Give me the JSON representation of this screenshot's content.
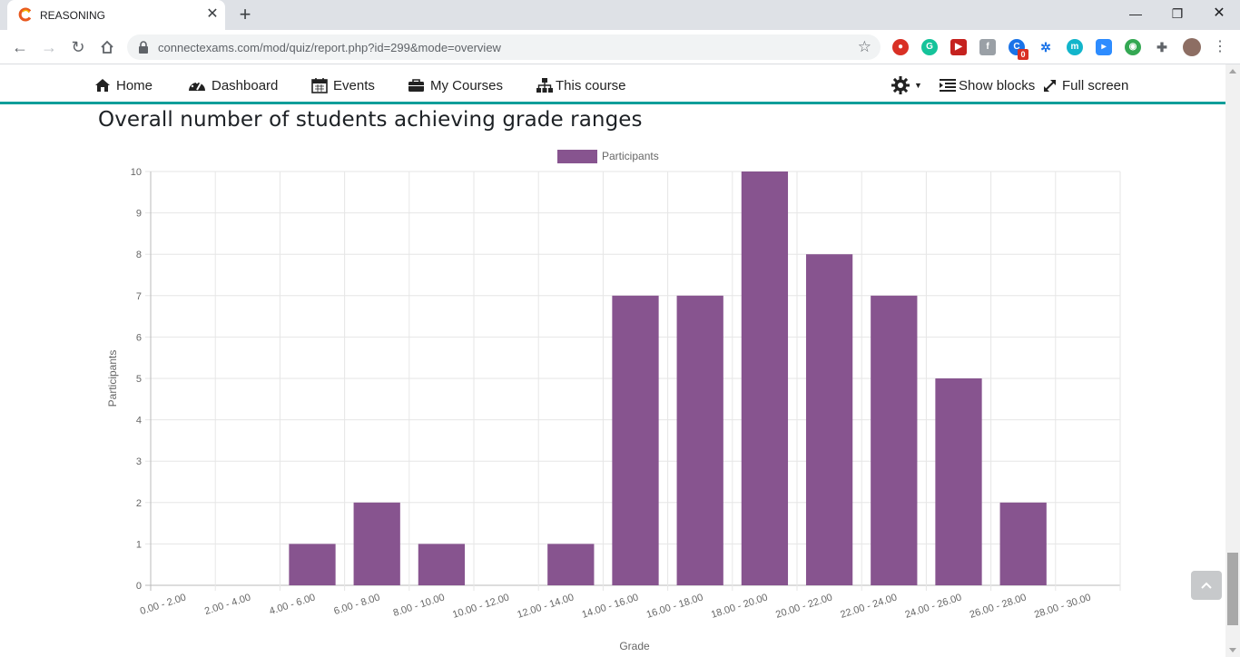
{
  "browser": {
    "tab_title": "REASONING",
    "url": "connectexams.com/mod/quiz/report.php?id=299&mode=overview",
    "extension_badge": "0"
  },
  "nav": {
    "home": "Home",
    "dashboard": "Dashboard",
    "events": "Events",
    "my_courses": "My Courses",
    "this_course": "This course",
    "show_blocks": "Show blocks",
    "full_screen": "Full screen"
  },
  "page": {
    "heading": "Overall number of students achieving grade ranges"
  },
  "colors": {
    "bar": "#87548f",
    "accent": "#0f9e9a"
  },
  "chart_data": {
    "type": "bar",
    "categories": [
      "0.00 - 2.00",
      "2.00 - 4.00",
      "4.00 - 6.00",
      "6.00 - 8.00",
      "8.00 - 10.00",
      "10.00 - 12.00",
      "12.00 - 14.00",
      "14.00 - 16.00",
      "16.00 - 18.00",
      "18.00 - 20.00",
      "20.00 - 22.00",
      "22.00 - 24.00",
      "24.00 - 26.00",
      "26.00 - 28.00",
      "28.00 - 30.00"
    ],
    "series": [
      {
        "name": "Participants",
        "values": [
          0,
          0,
          1,
          2,
          1,
          0,
          1,
          7,
          7,
          10,
          8,
          7,
          5,
          2,
          0
        ]
      }
    ],
    "xlabel": "Grade",
    "ylabel": "Participants",
    "ylim": [
      0,
      10
    ],
    "yticks": [
      0,
      1,
      2,
      3,
      4,
      5,
      6,
      7,
      8,
      9,
      10
    ],
    "grid": true,
    "legend": "top-center"
  }
}
